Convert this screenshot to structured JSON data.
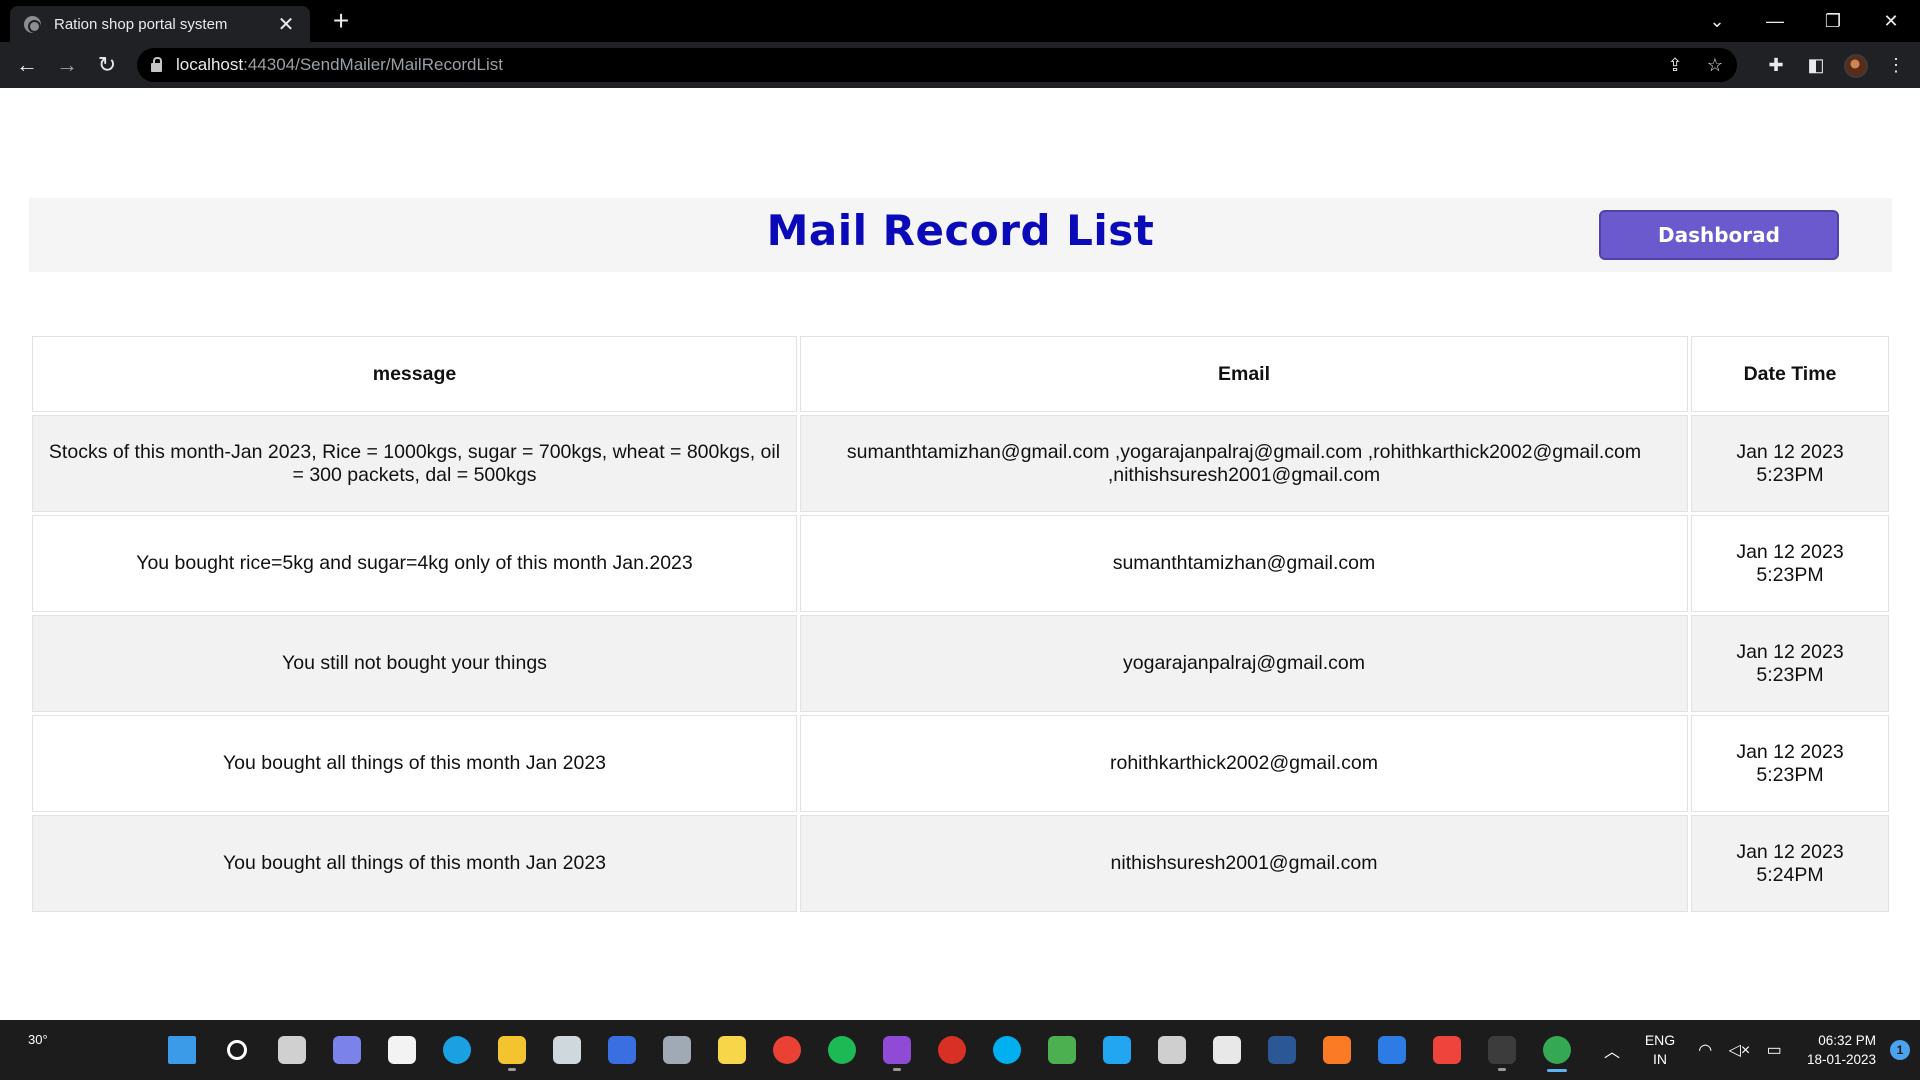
{
  "browser": {
    "tab_title": "Ration shop portal system",
    "tab_close": "✕",
    "new_tab": "+",
    "url_host": "localhost",
    "url_path": ":44304/SendMailer/MailRecordList"
  },
  "page": {
    "title": "Mail Record List",
    "dashboard_button": "Dashborad"
  },
  "table": {
    "headers": {
      "message": "message",
      "email": "Email",
      "datetime": "Date Time"
    },
    "rows": [
      {
        "message": "Stocks of this month-Jan 2023, Rice = 1000kgs, sugar = 700kgs, wheat = 800kgs, oil = 300 packets, dal = 500kgs",
        "email": "sumanthtamizhan@gmail.com ,yogarajanpalraj@gmail.com ,rohithkarthick2002@gmail.com ,nithishsuresh2001@gmail.com",
        "date": "Jan 12 2023",
        "time": "5:23PM"
      },
      {
        "message": "You bought rice=5kg and sugar=4kg only of this month Jan.2023",
        "email": "sumanthtamizhan@gmail.com",
        "date": "Jan 12 2023",
        "time": "5:23PM"
      },
      {
        "message": "You still not bought your things",
        "email": "yogarajanpalraj@gmail.com",
        "date": "Jan 12 2023",
        "time": "5:23PM"
      },
      {
        "message": "You bought all things of this month Jan 2023",
        "email": "rohithkarthick2002@gmail.com",
        "date": "Jan 12 2023",
        "time": "5:23PM"
      },
      {
        "message": "You bought all things of this month Jan 2023",
        "email": "nithishsuresh2001@gmail.com",
        "date": "Jan 12 2023",
        "time": "5:24PM"
      }
    ]
  },
  "taskbar": {
    "weather": "30°",
    "lang_line1": "ENG",
    "lang_line2": "IN",
    "time": "06:32 PM",
    "date": "18-01-2023",
    "notification_count": "1",
    "apps": [
      {
        "name": "start-icon",
        "color": "#3b9be8"
      },
      {
        "name": "search-icon",
        "color": "#ffffff"
      },
      {
        "name": "task-view-icon",
        "color": "#d0d0d0"
      },
      {
        "name": "teams-chat-icon",
        "color": "#7b83eb"
      },
      {
        "name": "microsoft-store-icon",
        "color": "#f3f3f3"
      },
      {
        "name": "edge-icon",
        "color": "#1ba1e2"
      },
      {
        "name": "file-explorer-icon",
        "color": "#f4c430"
      },
      {
        "name": "unity-icon",
        "color": "#cfd8dc"
      },
      {
        "name": "azure-data-studio-icon",
        "color": "#3a6fe2"
      },
      {
        "name": "settings-icon",
        "color": "#a0aab4"
      },
      {
        "name": "sticky-notes-icon",
        "color": "#f7d64a"
      },
      {
        "name": "chrome-icon",
        "color": "#e94235"
      },
      {
        "name": "spotify-icon",
        "color": "#1db954"
      },
      {
        "name": "visual-studio-icon",
        "color": "#8f4bd6"
      },
      {
        "name": "chrome-canary-icon",
        "color": "#d93025"
      },
      {
        "name": "skype-icon",
        "color": "#00aff0"
      },
      {
        "name": "sharex-icon",
        "color": "#4caf50"
      },
      {
        "name": "vscode-icon",
        "color": "#22a6f2"
      },
      {
        "name": "calculator-icon",
        "color": "#cfcfcf"
      },
      {
        "name": "notepad-icon",
        "color": "#e8e8e8"
      },
      {
        "name": "word-icon",
        "color": "#2b5797"
      },
      {
        "name": "xampp-icon",
        "color": "#fb7a24"
      },
      {
        "name": "security-icon",
        "color": "#2d7be5"
      },
      {
        "name": "anydesk-icon",
        "color": "#ef443b"
      },
      {
        "name": "terminal-icon",
        "color": "#3c3c3c"
      },
      {
        "name": "chrome-profile-icon",
        "color": "#34a853"
      }
    ]
  }
}
